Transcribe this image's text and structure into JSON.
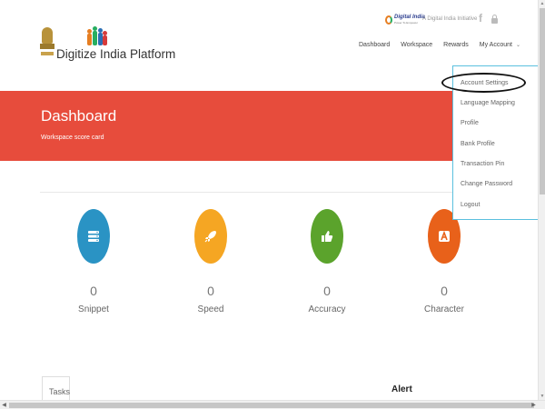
{
  "header": {
    "site_title": "Digitize India Platform",
    "digital_india_word": "Digital India",
    "digital_india_sub": "Power To Empower",
    "initiative_text": "A Digital India Initiative",
    "nav": [
      "Dashboard",
      "Workspace",
      "Rewards",
      "My Account"
    ]
  },
  "banner": {
    "title": "Dashboard",
    "subtitle": "Workspace score card",
    "color": "#e74c3c"
  },
  "stats": [
    {
      "label": "Snippet",
      "value": "0",
      "icon": "server-icon",
      "color": "#2a93c4"
    },
    {
      "label": "Speed",
      "value": "0",
      "icon": "rocket-icon",
      "color": "#f5a623"
    },
    {
      "label": "Accuracy",
      "value": "0",
      "icon": "thumbs-up-icon",
      "color": "#5ba32c"
    },
    {
      "label": "Character",
      "value": "0",
      "icon": "letter-a-icon",
      "color": "#e8611a"
    }
  ],
  "account_menu": {
    "items": [
      "Account Settings",
      "Language Mapping",
      "Profile",
      "Bank Profile",
      "Transaction Pin",
      "Change Password",
      "Logout"
    ]
  },
  "bottom": {
    "tasks_label": "Tasks",
    "alert_label": "Alert"
  }
}
